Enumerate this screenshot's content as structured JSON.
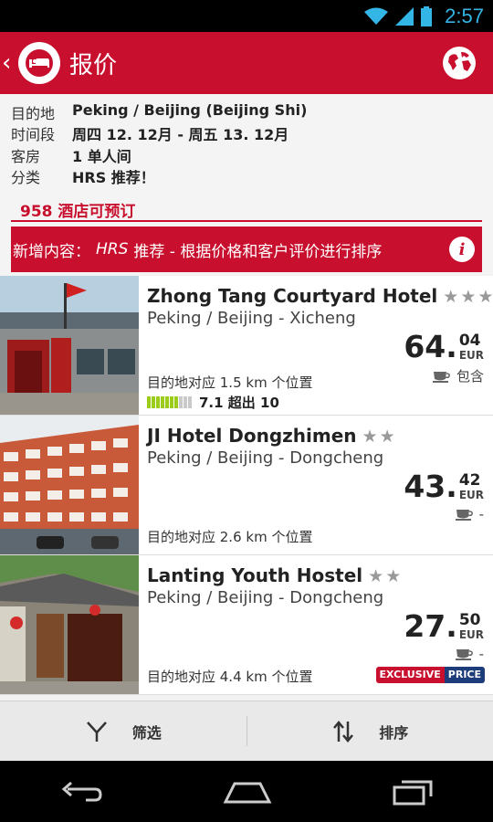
{
  "status_bar": {
    "time": "2:57"
  },
  "action_bar": {
    "title": "报价"
  },
  "search_info": {
    "rows": [
      {
        "label": "目的地",
        "value": "Peking / Beijing (Beijing Shi)"
      },
      {
        "label": "时间段",
        "value": "周四 12. 12月 - 周五 13. 12月"
      },
      {
        "label": "客房",
        "value": "1 单人间"
      },
      {
        "label": "分类",
        "value": "HRS 推荐！"
      }
    ],
    "hotel_count": "958 酒店可预订",
    "banner_prefix": "新增内容：",
    "banner_italic": "HRS",
    "banner_text": "推荐 - 根据价格和客户评价进行排序"
  },
  "hotels": [
    {
      "name": "Zhong Tang Courtyard Hotel",
      "stars": "★★★",
      "location": "Peking / Beijing - Xicheng",
      "price_int": "64.",
      "price_dec": "04",
      "currency": "EUR",
      "meal": "包含",
      "distance": "目的地对应 1.5 km 个位置",
      "rating_text": "7.1 超出 10",
      "rating_value": 7.1
    },
    {
      "name": "JI Hotel Dongzhimen",
      "stars": "★★",
      "location": "Peking / Beijing - Dongcheng",
      "price_int": "43.",
      "price_dec": "42",
      "currency": "EUR",
      "meal": "-",
      "distance": "目的地对应 2.6 km 个位置"
    },
    {
      "name": "Lanting Youth Hostel",
      "stars": "★★",
      "location": "Peking / Beijing - Dongcheng",
      "price_int": "27.",
      "price_dec": "50",
      "currency": "EUR",
      "meal": "-",
      "distance": "目的地对应 4.4 km 个位置",
      "badge_a": "EXCLUSIVE",
      "badge_b": "PRICE"
    }
  ],
  "toolbar": {
    "filter_label": "筛选",
    "sort_label": "排序"
  },
  "colors": {
    "brand_red": "#c8102e",
    "rating_green": "#9ccc1a",
    "status_blue": "#33b5e5"
  }
}
